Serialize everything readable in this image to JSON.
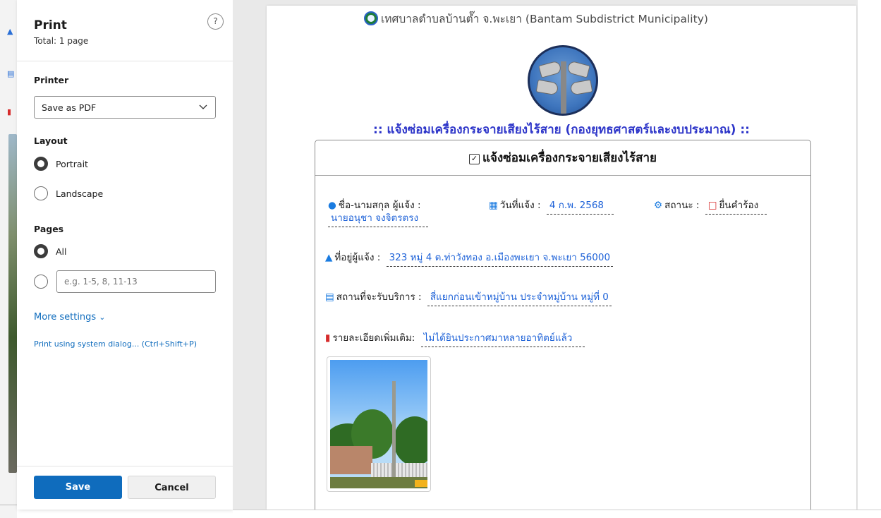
{
  "print_panel": {
    "title": "Print",
    "total": "Total: 1 page",
    "help": "?",
    "printer_label": "Printer",
    "printer_value": "Save as PDF",
    "layout_label": "Layout",
    "layout_options": [
      "Portrait",
      "Landscape"
    ],
    "layout_selected": "Portrait",
    "pages_label": "Pages",
    "pages_all": "All",
    "pages_placeholder": "e.g. 1-5, 8, 11-13",
    "more_settings": "More settings",
    "system_dialog": "Print using system dialog... (Ctrl+Shift+P)",
    "save": "Save",
    "cancel": "Cancel"
  },
  "document": {
    "municipality": "เทศบาลตำบลบ้านต๊ำ จ.พะเยา (Bantam Subdistrict Municipality)",
    "heading": ":: แจ้งซ่อมเครื่องกระจายเสียงไร้สาย (กองยุทธศาสตร์และงบประมาณ) ::",
    "card_title": "แจ้งซ่อมเครื่องกระจายเสียงไร้สาย",
    "fields": {
      "reporter_label": "ชื่อ-นามสกุล ผู้แจ้ง :",
      "reporter_value": "นายอนุชา จงจิตรตรง",
      "date_label": "วันที่แจ้ง :",
      "date_value": "4 ก.พ. 2568",
      "status_label": "สถานะ :",
      "status_value": "ยื่นคำร้อง",
      "address_label": "ที่อยู่ผู้แจ้ง :",
      "address_value": "323 หมู่ 4 ต.ท่าวังทอง อ.เมืองพะเยา จ.พะเยา 56000",
      "service_label": "สถานที่จะรับบริการ :",
      "service_value": "สี่แยกก่อนเข้าหมู่บ้าน ประจำหมู่บ้าน หมู่ที่ 0",
      "details_label": "รายละเอียดเพิ่มเติม:",
      "details_value": "ไม่ได้ยินประกาศมาหลายอาทิตย์แล้ว"
    }
  },
  "colors": {
    "accent": "#0f6cbd",
    "heading": "#2d35c9",
    "value": "#1f63d8",
    "status_red": "#d62b2b"
  }
}
